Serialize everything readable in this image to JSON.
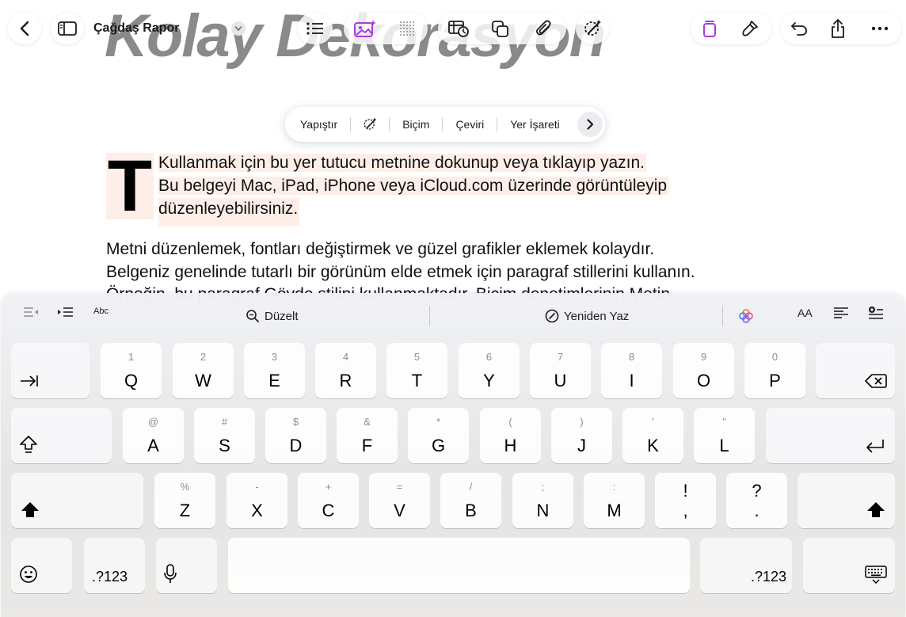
{
  "document": {
    "title": "Çağdaş Rapor",
    "heading": "Kolay Dekorasyon",
    "dropcap": "T",
    "highlighted_lines": [
      "Kullanmak için bu yer tutucu metnine dokunup veya tıklayıp yazın.",
      "Bu belgeyi Mac, iPad, iPhone veya iCloud.com üzerinde görüntüleyip",
      "düzenleyebilirsiniz."
    ],
    "body_lines": [
      "Metni düzenlemek, fontları değiştirmek ve güzel grafikler eklemek kolaydır.",
      "Belgeniz genelinde tutarlı bir görünüm elde etmek için paragraf stillerini kullanın.",
      "Örneğin, bu paragraf Gövde stilini kullanmaktadır. Biçim denetimlerinin Metin"
    ]
  },
  "context_menu": {
    "items": [
      "Yapıştır",
      "Biçim",
      "Çeviri",
      "Yer İşareti"
    ]
  },
  "keyboard": {
    "shortcut_bar": {
      "abc": "Abc",
      "proofread": "Düzelt",
      "rewrite": "Yeniden Yaz",
      "text_size": "AA"
    },
    "row1": [
      {
        "main": "Q",
        "alt": "1"
      },
      {
        "main": "W",
        "alt": "2"
      },
      {
        "main": "E",
        "alt": "3"
      },
      {
        "main": "R",
        "alt": "4"
      },
      {
        "main": "T",
        "alt": "5"
      },
      {
        "main": "Y",
        "alt": "6"
      },
      {
        "main": "U",
        "alt": "7"
      },
      {
        "main": "I",
        "alt": "8"
      },
      {
        "main": "O",
        "alt": "9"
      },
      {
        "main": "P",
        "alt": "0"
      }
    ],
    "row2": [
      {
        "main": "A",
        "alt": "@"
      },
      {
        "main": "S",
        "alt": "#"
      },
      {
        "main": "D",
        "alt": "$"
      },
      {
        "main": "F",
        "alt": "&"
      },
      {
        "main": "G",
        "alt": "*"
      },
      {
        "main": "H",
        "alt": "("
      },
      {
        "main": "J",
        "alt": ")"
      },
      {
        "main": "K",
        "alt": "'"
      },
      {
        "main": "L",
        "alt": "\""
      }
    ],
    "row3": [
      {
        "main": "Z",
        "alt": "%"
      },
      {
        "main": "X",
        "alt": "-"
      },
      {
        "main": "C",
        "alt": "+"
      },
      {
        "main": "V",
        "alt": "="
      },
      {
        "main": "B",
        "alt": "/"
      },
      {
        "main": "N",
        "alt": ";"
      },
      {
        "main": "M",
        "alt": ":"
      }
    ],
    "punct": [
      {
        "top": "!",
        "bottom": ","
      },
      {
        "top": "?",
        "bottom": "."
      }
    ],
    "numbers_label": ".?123"
  }
}
